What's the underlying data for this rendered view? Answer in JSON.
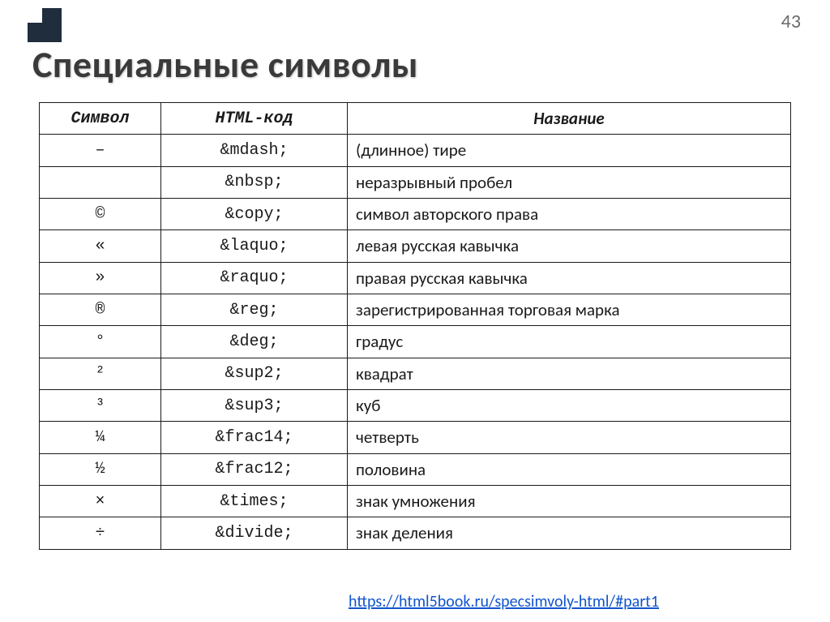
{
  "page_number": "43",
  "title": "Специальные символы",
  "headers": {
    "symbol": "Символ",
    "code": "HTML-код",
    "name": "Название"
  },
  "rows": [
    {
      "symbol": "–",
      "code": "&mdash;",
      "name": "(длинное) тире"
    },
    {
      "symbol": "",
      "code": "&nbsp;",
      "name": "неразрывный пробел"
    },
    {
      "symbol": "©",
      "code": "&copy;",
      "name": "символ авторского права"
    },
    {
      "symbol": "«",
      "code": "&laquo;",
      "name": "левая русская кавычка"
    },
    {
      "symbol": "»",
      "code": "&raquo;",
      "name": "правая русская кавычка"
    },
    {
      "symbol": "®",
      "code": "&reg;",
      "name": "зарегистрированная торговая марка"
    },
    {
      "symbol": "°",
      "code": "&deg;",
      "name": "градус"
    },
    {
      "symbol": "²",
      "code": "&sup2;",
      "name": "квадрат"
    },
    {
      "symbol": "³",
      "code": "&sup3;",
      "name": "куб"
    },
    {
      "symbol": "¼",
      "code": "&frac14;",
      "name": "четверть"
    },
    {
      "symbol": "½",
      "code": "&frac12;",
      "name": "половина"
    },
    {
      "symbol": "×",
      "code": "&times;",
      "name": "знак умножения"
    },
    {
      "symbol": "÷",
      "code": "&divide;",
      "name": "знак деления"
    }
  ],
  "footer_link": "https://html5book.ru/specsimvoly-html/#part1"
}
